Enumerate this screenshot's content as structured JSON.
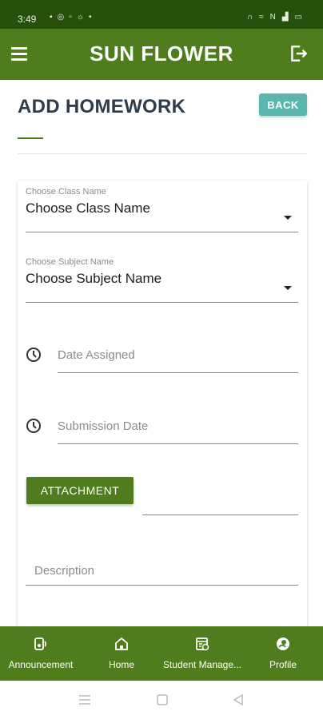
{
  "status_bar": {
    "time": "3:49",
    "left_icons": [
      "message-icon",
      "instagram-icon",
      "image-icon",
      "run-icon",
      "dot-icon"
    ],
    "right_icons": [
      "headset-icon",
      "wifi-icon",
      "nfc-icon",
      "signal-icon",
      "battery-icon"
    ]
  },
  "app_bar": {
    "title": "SUN FLOWER",
    "menu_icon": "menu-icon",
    "logout_icon": "logout-icon"
  },
  "page": {
    "title": "ADD HOMEWORK",
    "back_label": "BACK"
  },
  "form": {
    "class_field": {
      "label": "Choose Class Name",
      "value": "Choose Class Name"
    },
    "subject_field": {
      "label": "Choose Subject Name",
      "value": "Choose Subject Name"
    },
    "date_assigned_placeholder": "Date Assigned",
    "submission_date_placeholder": "Submission Date",
    "attachment_label": "ATTACHMENT",
    "description_placeholder": "Description"
  },
  "bottom_nav": {
    "items": [
      {
        "label": "Announcement",
        "icon": "announcement-icon"
      },
      {
        "label": "Home",
        "icon": "home-icon"
      },
      {
        "label": "Student Manage...",
        "icon": "student-management-icon"
      },
      {
        "label": "Profile",
        "icon": "profile-icon"
      }
    ]
  },
  "colors": {
    "primary": "#4f7d1d",
    "status_bar": "#28500d",
    "accent": "#5bb7ad",
    "title_text": "#2f3d4a"
  }
}
